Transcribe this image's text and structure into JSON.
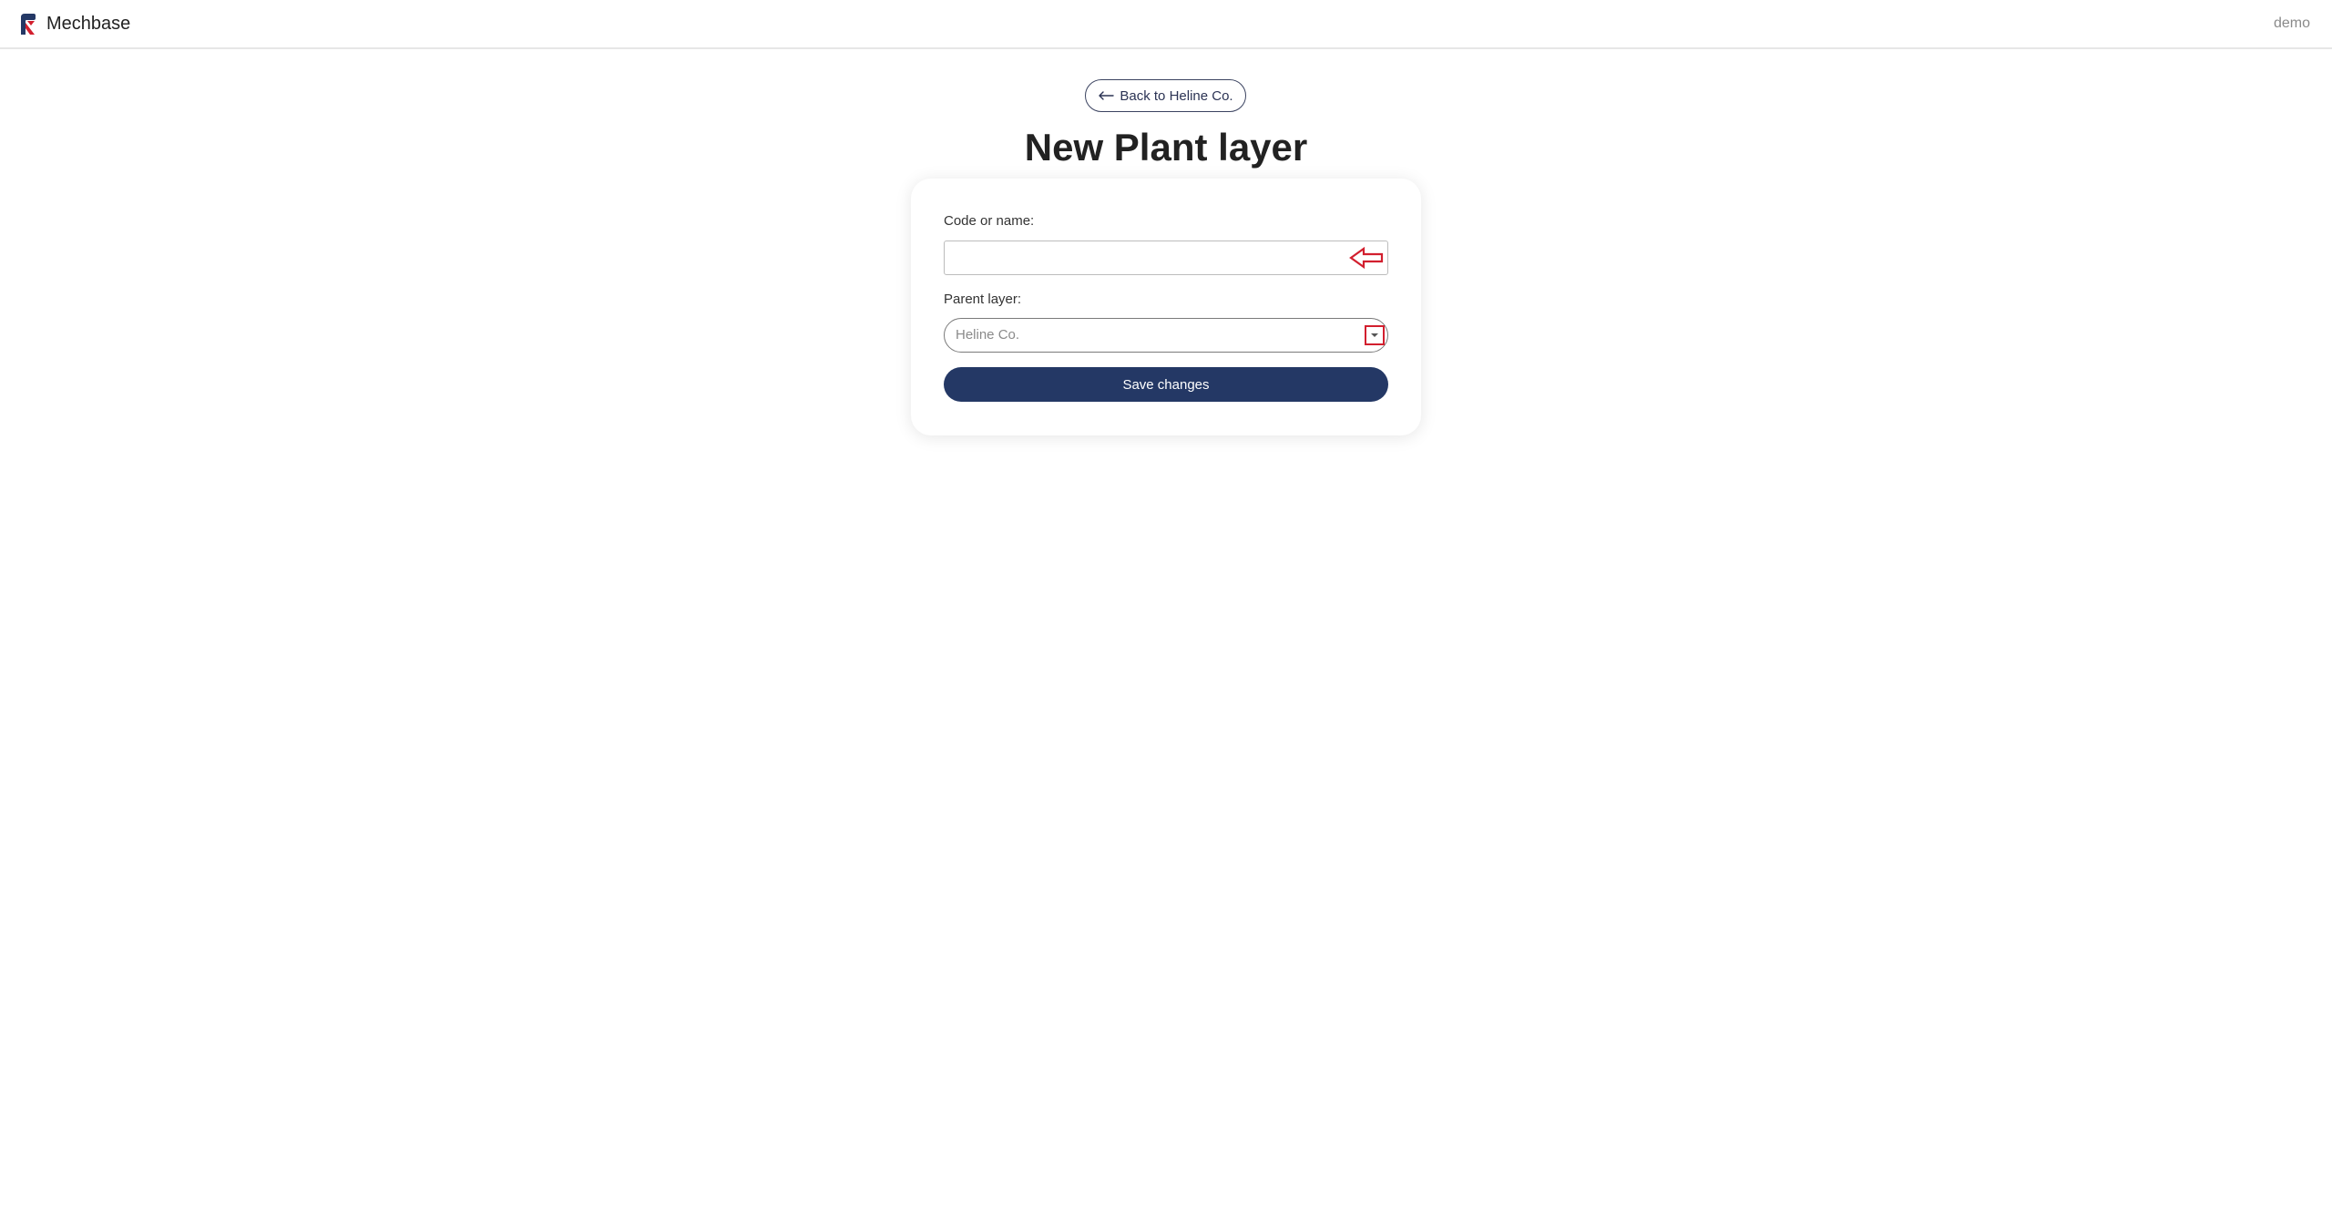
{
  "navbar": {
    "brand_name": "Mechbase",
    "logo_icon": "mechbase-logo-icon",
    "user_name": "demo"
  },
  "back_link": {
    "label": "Back to Heline Co.",
    "icon": "arrow-left-icon"
  },
  "page_title": "New Plant layer",
  "form": {
    "code_label": "Code or name:",
    "code_value": "",
    "code_hint_icon": "red-arrow-left-icon",
    "parent_label": "Parent layer:",
    "parent_value": "Heline Co.",
    "parent_caret_icon": "chevron-down-icon",
    "save_label": "Save changes"
  },
  "colors": {
    "primary": "#243865",
    "accent_red": "#d21f2e",
    "text_muted": "#8a8a8a"
  }
}
